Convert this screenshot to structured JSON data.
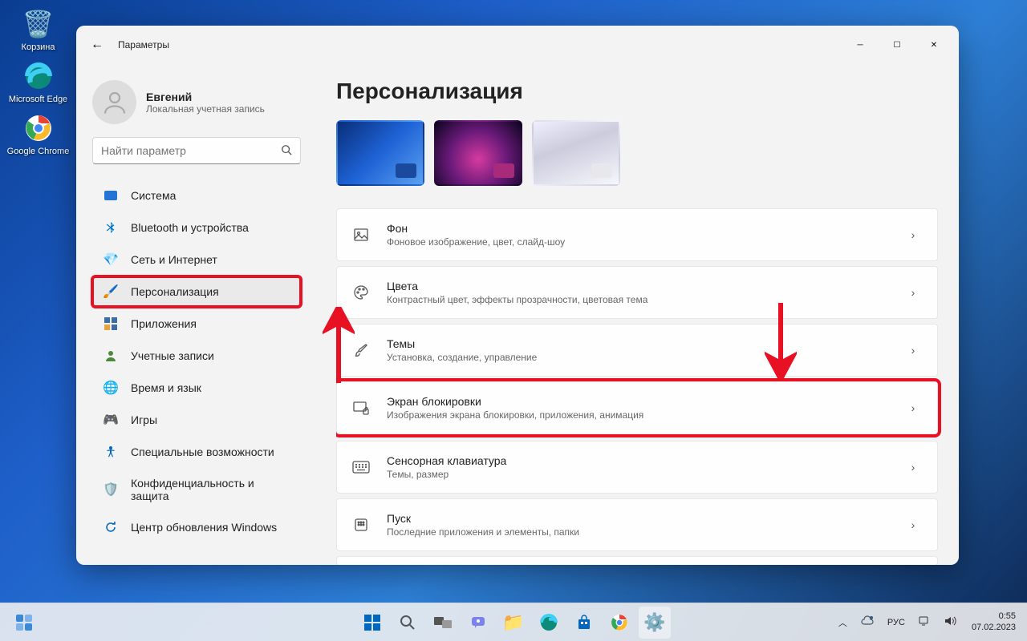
{
  "desktop": {
    "recycle_bin": "Корзина",
    "edge": "Microsoft Edge",
    "chrome": "Google Chrome"
  },
  "window": {
    "title": "Параметры",
    "user": {
      "name": "Евгений",
      "subtitle": "Локальная учетная запись"
    },
    "search_placeholder": "Найти параметр"
  },
  "nav": {
    "system": "Система",
    "bluetooth": "Bluetooth и устройства",
    "network": "Сеть и Интернет",
    "personalization": "Персонализация",
    "apps": "Приложения",
    "accounts": "Учетные записи",
    "time": "Время и язык",
    "gaming": "Игры",
    "accessibility": "Специальные возможности",
    "privacy": "Конфиденциальность и защита",
    "update": "Центр обновления Windows"
  },
  "page": {
    "title": "Персонализация"
  },
  "cards": {
    "background": {
      "title": "Фон",
      "sub": "Фоновое изображение, цвет, слайд-шоу"
    },
    "colors": {
      "title": "Цвета",
      "sub": "Контрастный цвет, эффекты прозрачности, цветовая тема"
    },
    "themes": {
      "title": "Темы",
      "sub": "Установка, создание, управление"
    },
    "lockscreen": {
      "title": "Экран блокировки",
      "sub": "Изображения экрана блокировки, приложения, анимация"
    },
    "keyboard": {
      "title": "Сенсорная клавиатура",
      "sub": "Темы, размер"
    },
    "start": {
      "title": "Пуск",
      "sub": "Последние приложения и элементы, папки"
    }
  },
  "taskbar": {
    "lang": "РУС",
    "time": "0:55",
    "date": "07.02.2023"
  }
}
